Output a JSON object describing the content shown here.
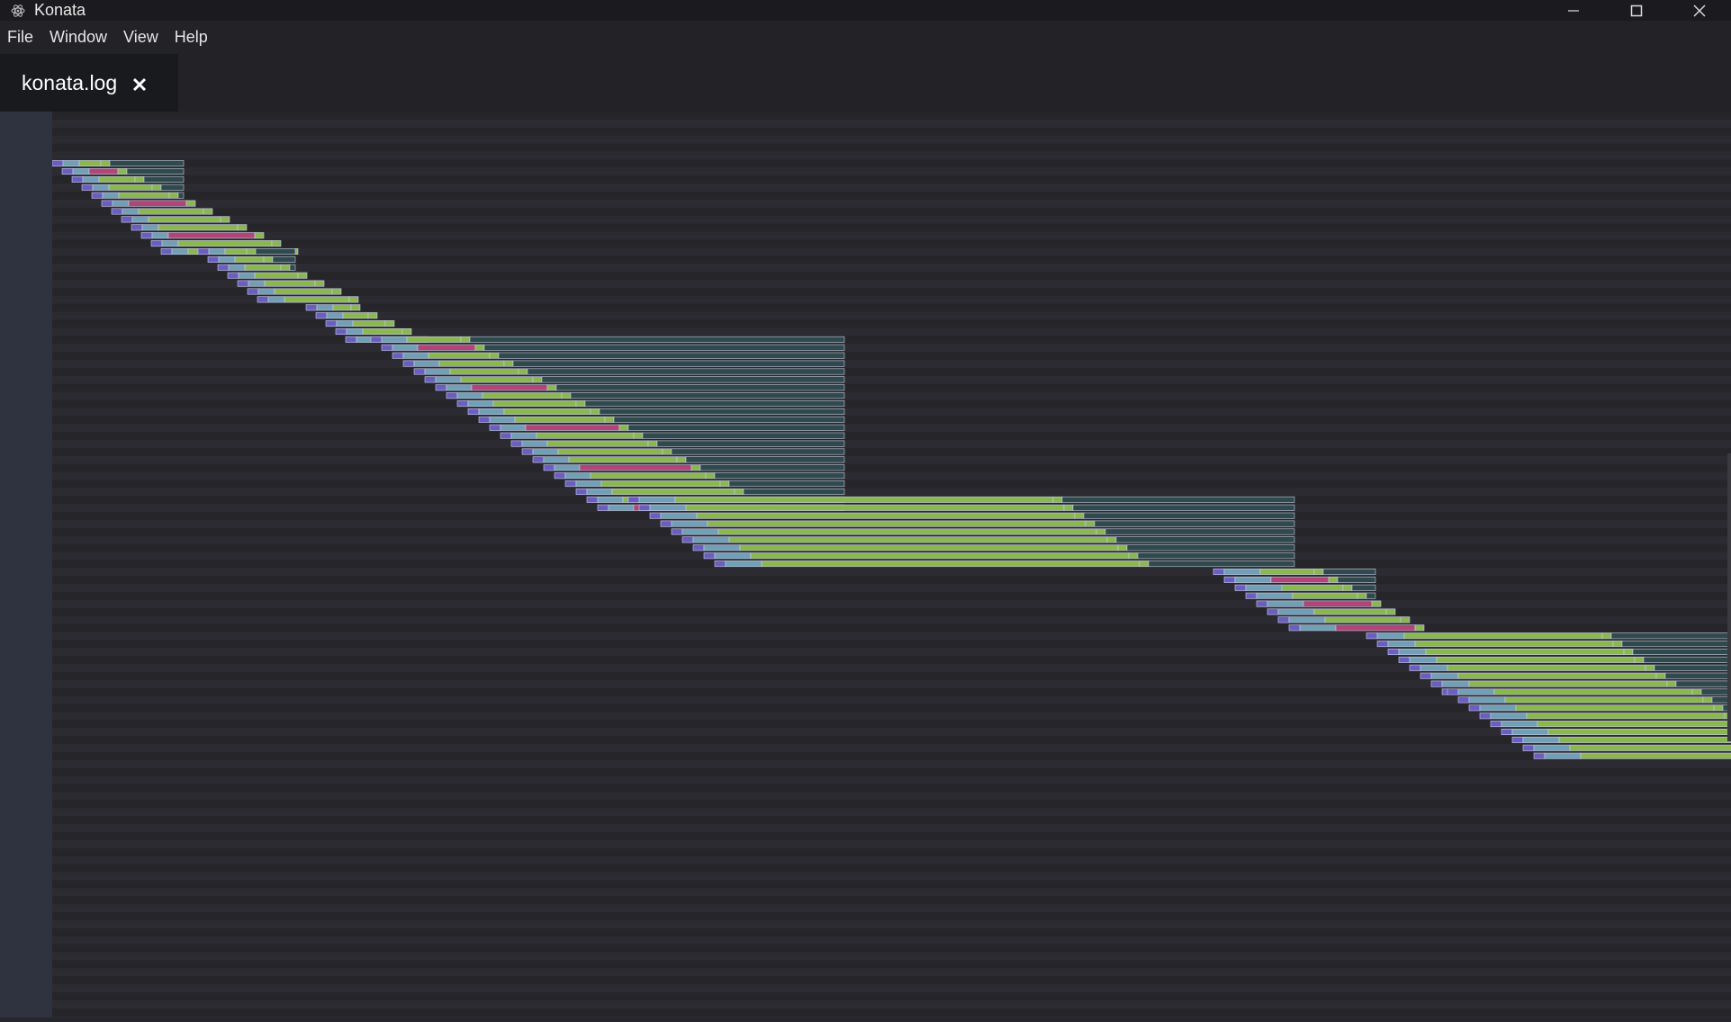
{
  "window": {
    "title": "Konata"
  },
  "menu": {
    "file": "File",
    "window": "Window",
    "view": "View",
    "help": "Help"
  },
  "tab": {
    "label": "konata.log"
  },
  "icons": {
    "app": "atom-icon",
    "minimize": "minimize-icon",
    "maximize": "maximize-icon",
    "close": "close-icon",
    "tab_close": "close-tab-icon"
  },
  "colors": {
    "titlebar": "#1b1b1f",
    "background": "#26262c",
    "row_band": "#2b2b31",
    "gutter": "#2f3340",
    "stage_fetch": "#6a5fc1",
    "stage_decode": "#6fa0b6",
    "stage_execute": "#8ab84f",
    "stage_stall": "#b04576",
    "stage_commit": "#2f4a4a"
  }
}
